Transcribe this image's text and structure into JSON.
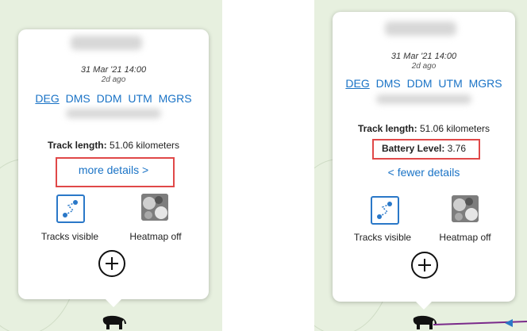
{
  "left_popup": {
    "date": "31 Mar '21 14:00",
    "ago": "2d ago",
    "coord_formats": [
      "DEG",
      "DMS",
      "DDM",
      "UTM",
      "MGRS"
    ],
    "track_length_label": "Track length:",
    "track_length_value": "51.06 kilometers",
    "more_details": "more details >",
    "tracks_label": "Tracks visible",
    "heatmap_label": "Heatmap off"
  },
  "right_popup": {
    "date": "31 Mar '21 14:00",
    "ago": "2d ago",
    "coord_formats": [
      "DEG",
      "DMS",
      "DDM",
      "UTM",
      "MGRS"
    ],
    "track_length_label": "Track length:",
    "track_length_value": "51.06 kilometers",
    "battery_label": "Battery Level:",
    "battery_value": "3.76",
    "fewer_details": "< fewer details",
    "tracks_label": "Tracks visible",
    "heatmap_label": "Heatmap off"
  },
  "icons": {
    "track": "tracks-icon",
    "heatmap": "heatmap-icon",
    "add": "plus-circle-icon",
    "marker": "elephant-icon"
  },
  "colors": {
    "link": "#1a73c6",
    "highlight": "#e04848",
    "map": "#e7f0df",
    "track_line": "#7a2a8a"
  }
}
